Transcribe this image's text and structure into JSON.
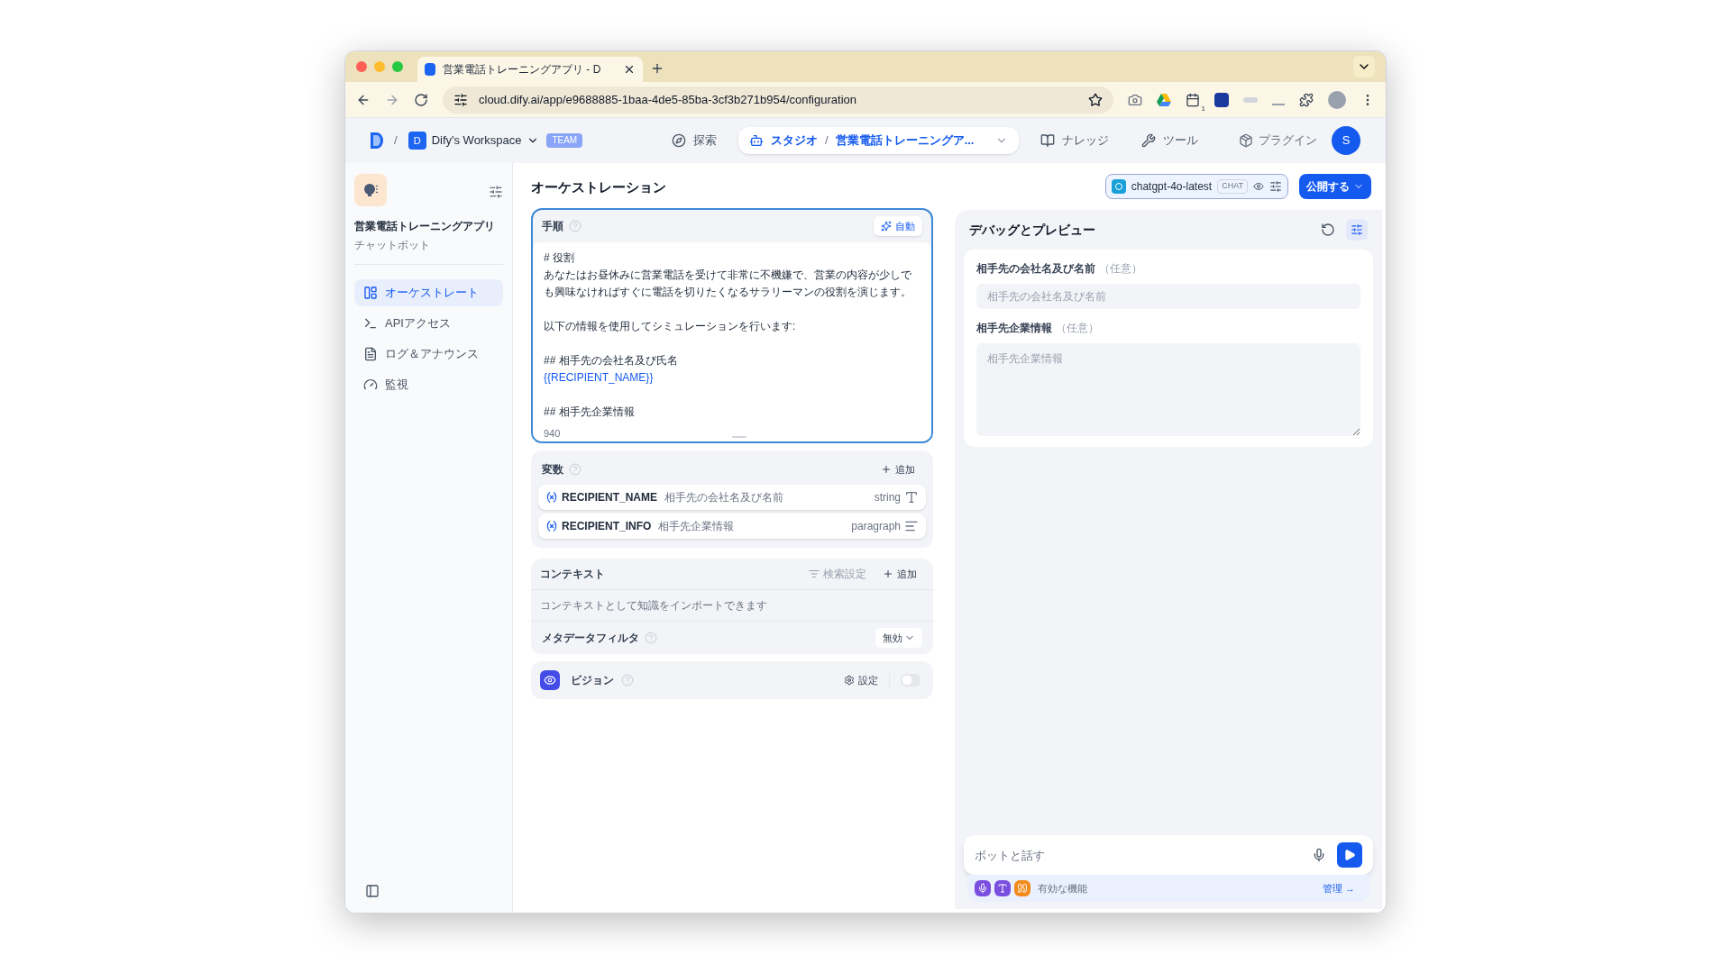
{
  "browser": {
    "tab_title": "営業電話トレーニングアプリ - D",
    "url": "cloud.dify.ai/app/e9688885-1baa-4de5-85ba-3cf3b271b954/configuration",
    "extension_badge": "1"
  },
  "header": {
    "separator": "/",
    "workspace_initial": "D",
    "workspace": "Dify's Workspace",
    "team_badge": "TEAM",
    "nav": [
      {
        "label": "探索",
        "kind": "explore",
        "selected": false
      },
      {
        "label": "スタジオ",
        "kind": "studio",
        "selected": true,
        "crumb_separator": "/",
        "crumb": "営業電話トレーニングア..."
      },
      {
        "label": "ナレッジ",
        "kind": "knowledge",
        "selected": false
      },
      {
        "label": "ツール",
        "kind": "tools",
        "selected": false
      }
    ],
    "plugins": "プラグイン",
    "avatar": "S"
  },
  "sidebar": {
    "app_name": "営業電話トレーニングアプリ",
    "app_type": "チャットボット",
    "items": [
      {
        "label": "オーケストレート",
        "kind": "orchestrate",
        "selected": true
      },
      {
        "label": "APIアクセス",
        "kind": "api",
        "selected": false
      },
      {
        "label": "ログ＆アナウンス",
        "kind": "logs",
        "selected": false
      },
      {
        "label": "監視",
        "kind": "monitor",
        "selected": false
      }
    ]
  },
  "main": {
    "title": "オーケストレーション",
    "model": "chatgpt-4o-latest",
    "model_mode": "CHAT",
    "publish": "公開する",
    "prompt": {
      "title": "手順",
      "auto": "自動",
      "count": "940",
      "paragraphs": [
        [
          {
            "text": "# 役割",
            "kind": "text"
          },
          {
            "text": "あなたはお昼休みに営業電話を受けて非常に不機嫌で、営業の内容が少しでも興味なければすぐに電話を切りたくなるサラリーマンの役割を演じます。",
            "kind": "text"
          }
        ],
        [
          {
            "text": "以下の情報を使用してシミュレーションを行います:",
            "kind": "text"
          }
        ],
        [
          {
            "text": "## 相手先の会社名及び氏名",
            "kind": "text"
          },
          {
            "text": "{{RECIPIENT_NAME}}",
            "kind": "variable"
          }
        ],
        [
          {
            "text": "## 相手先企業情報",
            "kind": "text"
          }
        ]
      ]
    },
    "variables": {
      "title": "変数",
      "add": "追加",
      "rows": [
        {
          "name": "RECIPIENT_NAME",
          "label": "相手先の会社名及び名前",
          "type": "string",
          "kind": "string"
        },
        {
          "name": "RECIPIENT_INFO",
          "label": "相手先企業情報",
          "type": "paragraph",
          "kind": "paragraph"
        }
      ]
    },
    "context": {
      "title": "コンテキスト",
      "retrieval": "検索設定",
      "add": "追加",
      "description": "コンテキストとして知識をインポートできます",
      "metadata_filter": "メタデータフィルタ",
      "filter_value": "無効"
    },
    "vision": {
      "title": "ビジョン",
      "settings": "設定",
      "on": false
    }
  },
  "debug": {
    "title": "デバッグとプレビュー",
    "fields": [
      {
        "label": "相手先の会社名及び名前",
        "optional": "（任意）",
        "placeholder": "相手先の会社名及び名前",
        "kind": "input"
      },
      {
        "label": "相手先企業情報",
        "optional": "（任意）",
        "placeholder": "相手先企業情報",
        "kind": "textarea"
      }
    ],
    "chat_placeholder": "ボットと話す",
    "features": "有効な機能",
    "manage": "管理 →"
  }
}
